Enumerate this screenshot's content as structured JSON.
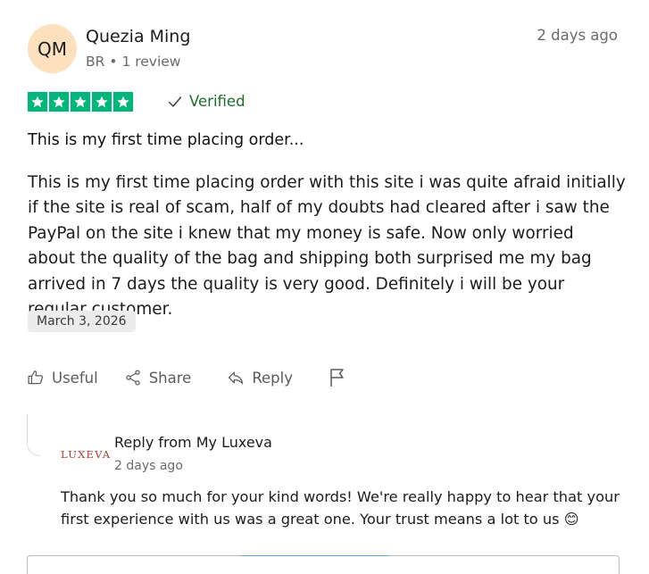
{
  "reviewer": {
    "initials": "QM",
    "name": "Quezia Ming",
    "country": "BR",
    "separator": "•",
    "review_count": "1 review",
    "time_ago": "2 days ago"
  },
  "rating": {
    "stars": 5,
    "max": 5,
    "color": "#00b67a"
  },
  "verified_label": "Verified",
  "review": {
    "title": "This is my first time placing order...",
    "body": "This is my first time placing order with this site i was quite afraid initially if the site is real of scam, half of my doubts had cleared after i saw the PayPal on the site i knew that my money is safe. Now only worried about the quality of the bag and shipping both surprised me my bag arrived in 7 days the quality is very good. Definitely i will be your regular customer.",
    "date": "March 3, 2026"
  },
  "actions": {
    "useful": "Useful",
    "share": "Share",
    "reply": "Reply"
  },
  "company_reply": {
    "logo_text": "LUXEVA",
    "heading": "Reply from My Luxeva",
    "time_ago": "2 days ago",
    "text": "Thank you so much for your kind words! We're really happy to hear that your first experience with us was a great one. Your trust means a lot to us 😊"
  }
}
